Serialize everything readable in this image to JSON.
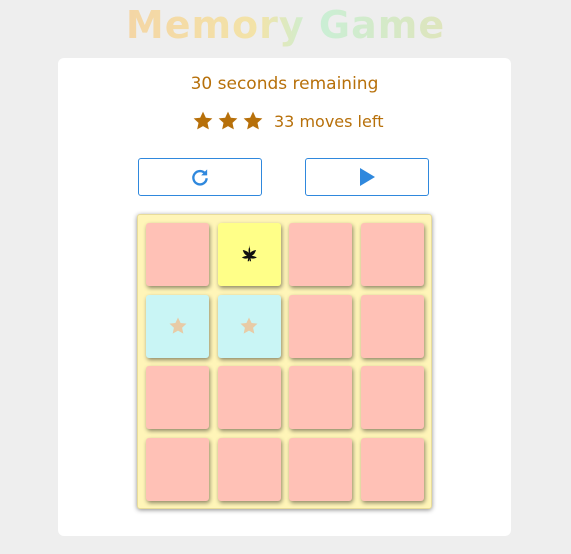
{
  "app": {
    "title": "Memory Game"
  },
  "score": {
    "timer_text": "30 seconds remaining",
    "moves_text": "33 moves left",
    "stars": 3
  },
  "controls": {
    "restart_icon": "restart-icon",
    "play_icon": "play-icon"
  },
  "colors": {
    "hidden_card": "#ffc1b6",
    "open_card": "#ffff88",
    "matched_card": "#c9f5f5",
    "board": "#fff5b8",
    "accent_text": "#b7700a",
    "button_border": "#2f88dd"
  },
  "board": {
    "rows": [
      [
        {
          "state": "hidden",
          "icon": ""
        },
        {
          "state": "open",
          "icon": "leaf-icon"
        },
        {
          "state": "hidden",
          "icon": ""
        },
        {
          "state": "hidden",
          "icon": ""
        }
      ],
      [
        {
          "state": "matched",
          "icon": "star-icon"
        },
        {
          "state": "matched",
          "icon": "star-icon"
        },
        {
          "state": "hidden",
          "icon": ""
        },
        {
          "state": "hidden",
          "icon": ""
        }
      ],
      [
        {
          "state": "hidden",
          "icon": ""
        },
        {
          "state": "hidden",
          "icon": ""
        },
        {
          "state": "hidden",
          "icon": ""
        },
        {
          "state": "hidden",
          "icon": ""
        }
      ],
      [
        {
          "state": "hidden",
          "icon": ""
        },
        {
          "state": "hidden",
          "icon": ""
        },
        {
          "state": "hidden",
          "icon": ""
        },
        {
          "state": "hidden",
          "icon": ""
        }
      ]
    ]
  }
}
